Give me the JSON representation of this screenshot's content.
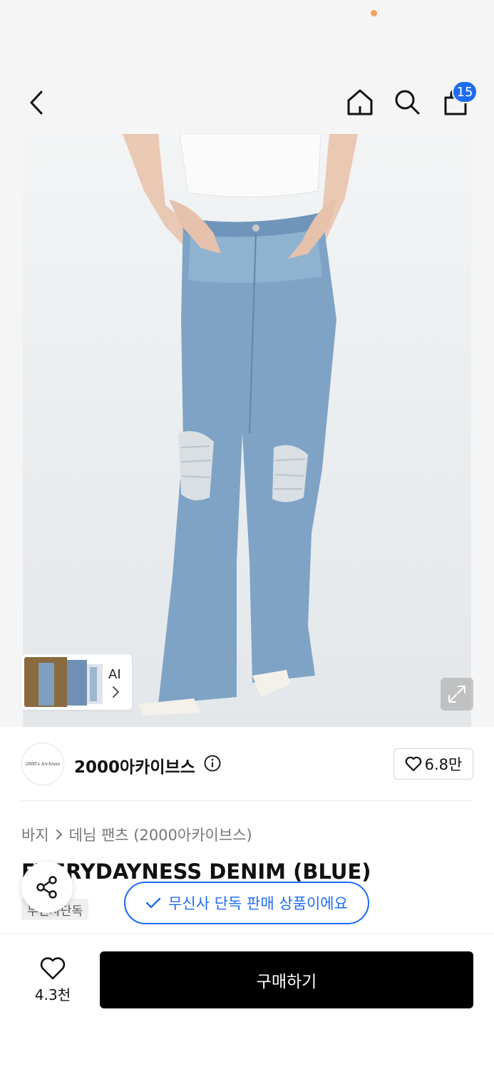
{
  "header": {
    "cart_count": "15"
  },
  "ai_card": {
    "label": "AI"
  },
  "brand": {
    "logo_text": "2000's Archives",
    "name": "2000아카이브스",
    "likes": "6.8만"
  },
  "breadcrumb": {
    "category": "바지",
    "subcategory": "데님 팬츠 (2000아카이브스)"
  },
  "product": {
    "title": "EVERYDAYNESS DENIM (BLUE)",
    "exclusive_tag": "무신사단독"
  },
  "toast": {
    "text": "무신사 단독 판매 상품이에요"
  },
  "bottom": {
    "wish_count": "4.3천",
    "buy_label": "구매하기"
  },
  "colors": {
    "accent": "#1d6cf2",
    "status_dot": "#f2a25a",
    "buy_button": "#000000"
  }
}
